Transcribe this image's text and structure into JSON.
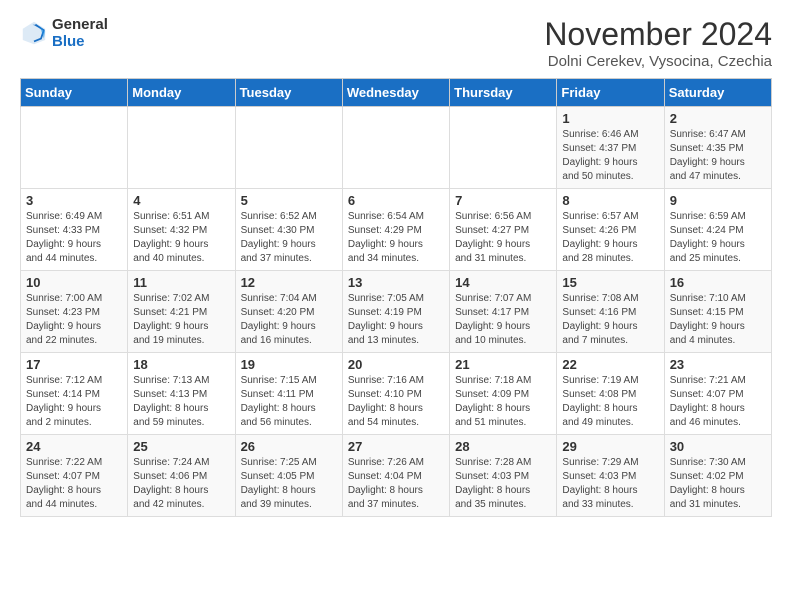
{
  "header": {
    "logo_general": "General",
    "logo_blue": "Blue",
    "month_title": "November 2024",
    "subtitle": "Dolni Cerekev, Vysocina, Czechia"
  },
  "days_of_week": [
    "Sunday",
    "Monday",
    "Tuesday",
    "Wednesday",
    "Thursday",
    "Friday",
    "Saturday"
  ],
  "weeks": [
    [
      {
        "day": "",
        "detail": ""
      },
      {
        "day": "",
        "detail": ""
      },
      {
        "day": "",
        "detail": ""
      },
      {
        "day": "",
        "detail": ""
      },
      {
        "day": "",
        "detail": ""
      },
      {
        "day": "1",
        "detail": "Sunrise: 6:46 AM\nSunset: 4:37 PM\nDaylight: 9 hours\nand 50 minutes."
      },
      {
        "day": "2",
        "detail": "Sunrise: 6:47 AM\nSunset: 4:35 PM\nDaylight: 9 hours\nand 47 minutes."
      }
    ],
    [
      {
        "day": "3",
        "detail": "Sunrise: 6:49 AM\nSunset: 4:33 PM\nDaylight: 9 hours\nand 44 minutes."
      },
      {
        "day": "4",
        "detail": "Sunrise: 6:51 AM\nSunset: 4:32 PM\nDaylight: 9 hours\nand 40 minutes."
      },
      {
        "day": "5",
        "detail": "Sunrise: 6:52 AM\nSunset: 4:30 PM\nDaylight: 9 hours\nand 37 minutes."
      },
      {
        "day": "6",
        "detail": "Sunrise: 6:54 AM\nSunset: 4:29 PM\nDaylight: 9 hours\nand 34 minutes."
      },
      {
        "day": "7",
        "detail": "Sunrise: 6:56 AM\nSunset: 4:27 PM\nDaylight: 9 hours\nand 31 minutes."
      },
      {
        "day": "8",
        "detail": "Sunrise: 6:57 AM\nSunset: 4:26 PM\nDaylight: 9 hours\nand 28 minutes."
      },
      {
        "day": "9",
        "detail": "Sunrise: 6:59 AM\nSunset: 4:24 PM\nDaylight: 9 hours\nand 25 minutes."
      }
    ],
    [
      {
        "day": "10",
        "detail": "Sunrise: 7:00 AM\nSunset: 4:23 PM\nDaylight: 9 hours\nand 22 minutes."
      },
      {
        "day": "11",
        "detail": "Sunrise: 7:02 AM\nSunset: 4:21 PM\nDaylight: 9 hours\nand 19 minutes."
      },
      {
        "day": "12",
        "detail": "Sunrise: 7:04 AM\nSunset: 4:20 PM\nDaylight: 9 hours\nand 16 minutes."
      },
      {
        "day": "13",
        "detail": "Sunrise: 7:05 AM\nSunset: 4:19 PM\nDaylight: 9 hours\nand 13 minutes."
      },
      {
        "day": "14",
        "detail": "Sunrise: 7:07 AM\nSunset: 4:17 PM\nDaylight: 9 hours\nand 10 minutes."
      },
      {
        "day": "15",
        "detail": "Sunrise: 7:08 AM\nSunset: 4:16 PM\nDaylight: 9 hours\nand 7 minutes."
      },
      {
        "day": "16",
        "detail": "Sunrise: 7:10 AM\nSunset: 4:15 PM\nDaylight: 9 hours\nand 4 minutes."
      }
    ],
    [
      {
        "day": "17",
        "detail": "Sunrise: 7:12 AM\nSunset: 4:14 PM\nDaylight: 9 hours\nand 2 minutes."
      },
      {
        "day": "18",
        "detail": "Sunrise: 7:13 AM\nSunset: 4:13 PM\nDaylight: 8 hours\nand 59 minutes."
      },
      {
        "day": "19",
        "detail": "Sunrise: 7:15 AM\nSunset: 4:11 PM\nDaylight: 8 hours\nand 56 minutes."
      },
      {
        "day": "20",
        "detail": "Sunrise: 7:16 AM\nSunset: 4:10 PM\nDaylight: 8 hours\nand 54 minutes."
      },
      {
        "day": "21",
        "detail": "Sunrise: 7:18 AM\nSunset: 4:09 PM\nDaylight: 8 hours\nand 51 minutes."
      },
      {
        "day": "22",
        "detail": "Sunrise: 7:19 AM\nSunset: 4:08 PM\nDaylight: 8 hours\nand 49 minutes."
      },
      {
        "day": "23",
        "detail": "Sunrise: 7:21 AM\nSunset: 4:07 PM\nDaylight: 8 hours\nand 46 minutes."
      }
    ],
    [
      {
        "day": "24",
        "detail": "Sunrise: 7:22 AM\nSunset: 4:07 PM\nDaylight: 8 hours\nand 44 minutes."
      },
      {
        "day": "25",
        "detail": "Sunrise: 7:24 AM\nSunset: 4:06 PM\nDaylight: 8 hours\nand 42 minutes."
      },
      {
        "day": "26",
        "detail": "Sunrise: 7:25 AM\nSunset: 4:05 PM\nDaylight: 8 hours\nand 39 minutes."
      },
      {
        "day": "27",
        "detail": "Sunrise: 7:26 AM\nSunset: 4:04 PM\nDaylight: 8 hours\nand 37 minutes."
      },
      {
        "day": "28",
        "detail": "Sunrise: 7:28 AM\nSunset: 4:03 PM\nDaylight: 8 hours\nand 35 minutes."
      },
      {
        "day": "29",
        "detail": "Sunrise: 7:29 AM\nSunset: 4:03 PM\nDaylight: 8 hours\nand 33 minutes."
      },
      {
        "day": "30",
        "detail": "Sunrise: 7:30 AM\nSunset: 4:02 PM\nDaylight: 8 hours\nand 31 minutes."
      }
    ]
  ]
}
